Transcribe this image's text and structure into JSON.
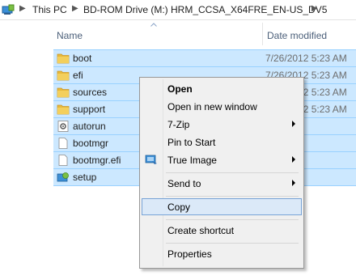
{
  "address_bar": {
    "crumbs": [
      "This PC",
      "BD-ROM Drive (M:) HRM_CCSA_X64FRE_EN-US_DV5"
    ]
  },
  "columns": {
    "name": "Name",
    "date_modified": "Date modified"
  },
  "files": [
    {
      "name": "boot",
      "date": "7/26/2012 5:23 AM",
      "icon": "folder-icon"
    },
    {
      "name": "efi",
      "date": "7/26/2012 5:23 AM",
      "icon": "folder-icon"
    },
    {
      "name": "sources",
      "date": "7/26/2012 5:23 AM",
      "icon": "folder-icon"
    },
    {
      "name": "support",
      "date": "7/26/2012 5:23 AM",
      "icon": "folder-icon"
    },
    {
      "name": "autorun",
      "date": "",
      "icon": "settings-file-icon"
    },
    {
      "name": "bootmgr",
      "date": "",
      "icon": "file-icon"
    },
    {
      "name": "bootmgr.efi",
      "date": "",
      "icon": "file-icon"
    },
    {
      "name": "setup",
      "date": "",
      "icon": "setup-icon"
    }
  ],
  "context_menu": {
    "items": {
      "open": "Open",
      "open_new_window": "Open in new window",
      "seven_zip": "7-Zip",
      "pin_to_start": "Pin to Start",
      "true_image": "True Image",
      "send_to": "Send to",
      "copy": "Copy",
      "create_shortcut": "Create shortcut",
      "properties": "Properties"
    }
  },
  "colors": {
    "selection_bg": "#cce8ff",
    "selection_border": "#99d1ff",
    "menu_highlight": "#dbe9f8",
    "folder": "#e8b93a"
  }
}
